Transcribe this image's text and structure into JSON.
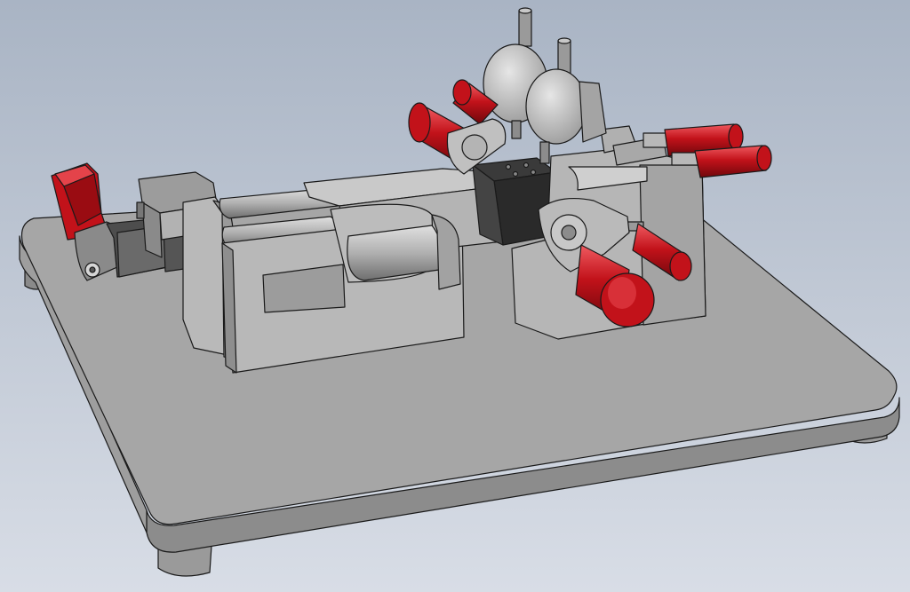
{
  "viewport": {
    "background_top": "#a9b4c4",
    "background_bottom": "#d8dde6"
  },
  "colors": {
    "body_light": "#c4c4c4",
    "body_mid": "#a8a8a8",
    "body_dark": "#7e7e7e",
    "body_shadow": "#5c5c5c",
    "outline": "#1a1a1a",
    "red": "#c2121a",
    "red_light": "#e4434a",
    "red_dark": "#7a0a10",
    "black_part": "#2a2a2a"
  },
  "parts": [
    {
      "name": "base-plate",
      "type": "plate"
    },
    {
      "name": "toggle-clamp",
      "type": "clamp"
    },
    {
      "name": "guide-rails",
      "type": "rail"
    },
    {
      "name": "slide-carriage",
      "type": "block"
    },
    {
      "name": "measuring-block",
      "type": "block"
    },
    {
      "name": "dial-indicator-left",
      "type": "gauge"
    },
    {
      "name": "dial-indicator-right",
      "type": "gauge"
    },
    {
      "name": "red-knob-handles",
      "type": "handle"
    }
  ]
}
